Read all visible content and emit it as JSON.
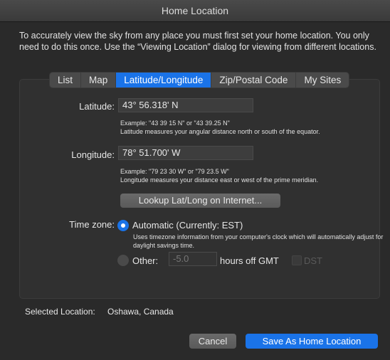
{
  "window": {
    "title": "Home Location"
  },
  "intro": "To accurately view the sky from any place you must first set your home location. You only need to do this once. Use the “Viewing Location” dialog for viewing from different locations.",
  "tabs": [
    {
      "label": "List"
    },
    {
      "label": "Map"
    },
    {
      "label": "Latitude/Longitude",
      "active": true
    },
    {
      "label": "Zip/Postal Code"
    },
    {
      "label": "My Sites"
    }
  ],
  "latitude": {
    "label": "Latitude:",
    "value": "43° 56.318' N",
    "example": "Example: \"43 39 15 N\" or \"43 39.25 N\"",
    "description": "Latitude measures your angular distance north or south of the equator."
  },
  "longitude": {
    "label": "Longitude:",
    "value": "78° 51.700' W",
    "example": "Example: \"79 23 30 W\" or \"79 23.5 W\"",
    "description": "Longitude measures your distance east or west of the prime meridian."
  },
  "lookup_button": "Lookup Lat/Long on Internet...",
  "timezone": {
    "label": "Time zone:",
    "automatic_label": "Automatic (Currently: EST)",
    "automatic_desc_line1": "Uses timezone information from your computer's clock which will automatically adjust for",
    "automatic_desc_line2": "daylight savings time.",
    "other_label": "Other:",
    "other_value": "-5.0",
    "hours_label": "hours off GMT",
    "dst_label": "DST"
  },
  "selected_location": {
    "label": "Selected Location:",
    "value": "Oshawa, Canada"
  },
  "buttons": {
    "cancel": "Cancel",
    "save": "Save As Home Location"
  },
  "colors": {
    "accent": "#1a73e8",
    "background": "#2a2a2a"
  }
}
